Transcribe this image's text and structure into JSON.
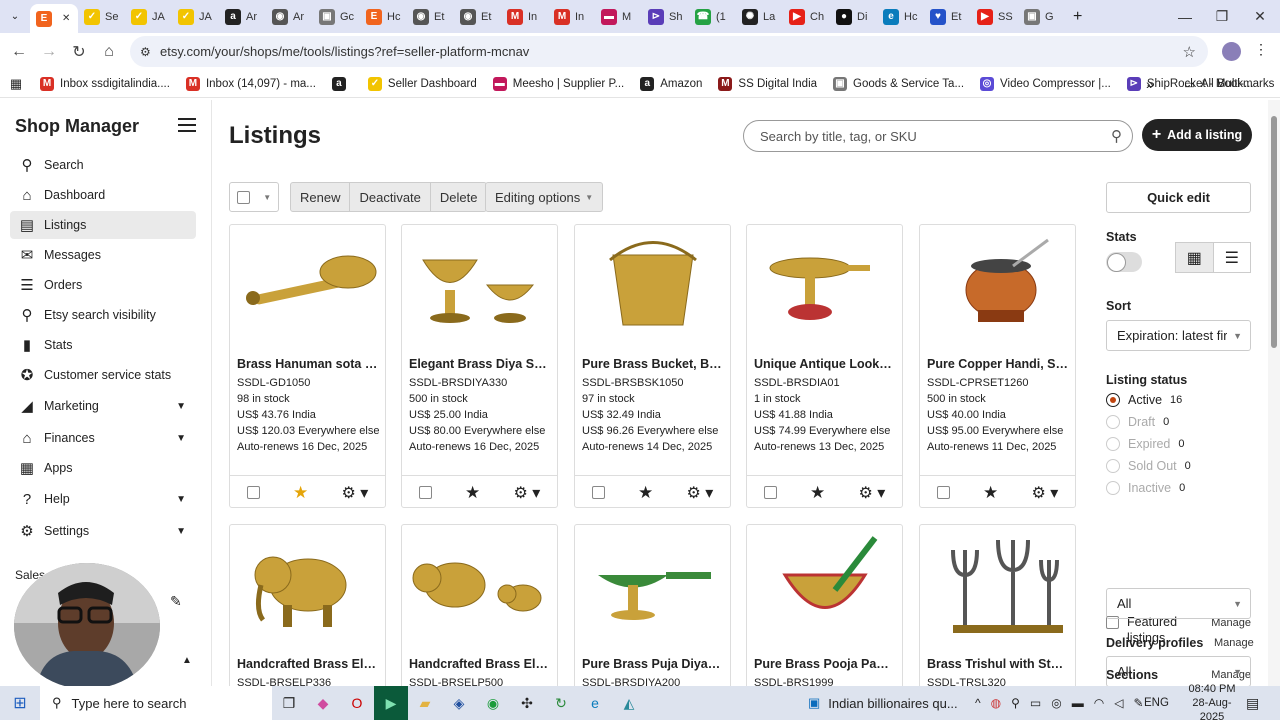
{
  "browser": {
    "tabs": [
      {
        "label": "",
        "icon": "etsy-icon",
        "color": "#f1641e",
        "glyph": "E",
        "active": true
      },
      {
        "label": "Se",
        "icon": "seller-icon",
        "color": "#f2c400",
        "glyph": "✓"
      },
      {
        "label": "JA",
        "icon": "seller-icon",
        "color": "#f2c400",
        "glyph": "✓"
      },
      {
        "label": "JA",
        "icon": "seller-icon",
        "color": "#f2c400",
        "glyph": "✓"
      },
      {
        "label": "Ar",
        "icon": "amazon-icon",
        "color": "#222",
        "glyph": "a"
      },
      {
        "label": "Ar",
        "icon": "globe-icon",
        "color": "#555",
        "glyph": "◉"
      },
      {
        "label": "Gc",
        "icon": "gst-icon",
        "color": "#777",
        "glyph": "▣"
      },
      {
        "label": "Hc",
        "icon": "etsy-icon",
        "color": "#f1641e",
        "glyph": "E"
      },
      {
        "label": "Et",
        "icon": "globe-icon",
        "color": "#555",
        "glyph": "◉"
      },
      {
        "label": "Et",
        "icon": "globe-icon",
        "color": "#555",
        "glyph": "◉"
      },
      {
        "label": "In",
        "icon": "gmail-icon",
        "color": "#d93025",
        "glyph": "M"
      },
      {
        "label": "In",
        "icon": "gmail-icon",
        "color": "#d93025",
        "glyph": "M"
      },
      {
        "label": "M",
        "icon": "meesho-icon",
        "color": "#c2185b",
        "glyph": "▬"
      },
      {
        "label": "Sh",
        "icon": "shiprocket-icon",
        "color": "#5a3db8",
        "glyph": "⊳"
      },
      {
        "label": "(1",
        "icon": "whatsapp-icon",
        "color": "#25a244",
        "glyph": "☎"
      },
      {
        "label": "La",
        "icon": "openai-icon",
        "color": "#222",
        "glyph": "✺"
      },
      {
        "label": "Ch",
        "icon": "youtube-icon",
        "color": "#e62117",
        "glyph": "▶"
      },
      {
        "label": "Di",
        "icon": "openai-icon",
        "color": "#111",
        "glyph": "●"
      },
      {
        "label": "Hc",
        "icon": "edge-icon",
        "color": "#0a7cbc",
        "glyph": "e"
      },
      {
        "label": "Et",
        "icon": "heart-icon",
        "color": "#2452c9",
        "glyph": "♥"
      },
      {
        "label": "SS",
        "icon": "youtube-icon",
        "color": "#e62117",
        "glyph": "▶"
      },
      {
        "label": "G",
        "icon": "gst-icon",
        "color": "#777",
        "glyph": "▣"
      }
    ],
    "new_tab": "+",
    "url": "etsy.com/your/shops/me/tools/listings?ref=seller-platform-mcnav",
    "bookmarks": [
      {
        "label": "Inbox ssdigitalindia....",
        "icon": "gmail-icon",
        "color": "#d93025",
        "glyph": "M"
      },
      {
        "label": "Inbox (14,097) - ma...",
        "icon": "gmail-icon",
        "color": "#d93025",
        "glyph": "M"
      },
      {
        "label": "",
        "icon": "amazon-icon",
        "color": "#222",
        "glyph": "a"
      },
      {
        "label": "Seller Dashboard",
        "icon": "seller-icon",
        "color": "#f2c400",
        "glyph": "✓"
      },
      {
        "label": "Meesho | Supplier P...",
        "icon": "meesho-icon",
        "color": "#c2185b",
        "glyph": "▬"
      },
      {
        "label": "Amazon",
        "icon": "amazon-icon",
        "color": "#222",
        "glyph": "a"
      },
      {
        "label": "SS Digital India",
        "icon": "ss-icon",
        "color": "#8b1a1a",
        "glyph": "M"
      },
      {
        "label": "Goods & Service Ta...",
        "icon": "gst-icon",
        "color": "#777",
        "glyph": "▣"
      },
      {
        "label": "Video Compressor |...",
        "icon": "video-icon",
        "color": "#5b4bd6",
        "glyph": "◎"
      },
      {
        "label": "ShipRocket - Multi-...",
        "icon": "shiprocket-icon",
        "color": "#5a3db8",
        "glyph": "⊳"
      }
    ],
    "more_bookmarks": "»",
    "all_bookmarks": "All Bookmarks"
  },
  "sidebar": {
    "title": "Shop Manager",
    "items": [
      {
        "label": "Search",
        "icon": "search-icon",
        "glyph": "⚲",
        "chevron": ""
      },
      {
        "label": "Dashboard",
        "icon": "home-icon",
        "glyph": "⌂",
        "chevron": ""
      },
      {
        "label": "Listings",
        "icon": "listings-icon",
        "glyph": "▤",
        "chevron": "",
        "active": true
      },
      {
        "label": "Messages",
        "icon": "messages-icon",
        "glyph": "✉",
        "chevron": ""
      },
      {
        "label": "Orders",
        "icon": "orders-icon",
        "glyph": "☰",
        "chevron": ""
      },
      {
        "label": "Etsy search visibility",
        "icon": "magnifier-icon",
        "glyph": "⚲",
        "chevron": ""
      },
      {
        "label": "Stats",
        "icon": "stats-icon",
        "glyph": "▮",
        "chevron": ""
      },
      {
        "label": "Customer service stats",
        "icon": "badge-icon",
        "glyph": "✪",
        "chevron": ""
      },
      {
        "label": "Marketing",
        "icon": "megaphone-icon",
        "glyph": "◢",
        "chevron": "▼"
      },
      {
        "label": "Finances",
        "icon": "bank-icon",
        "glyph": "⌂",
        "chevron": "▼"
      },
      {
        "label": "Apps",
        "icon": "apps-icon",
        "glyph": "▦",
        "chevron": ""
      },
      {
        "label": "Help",
        "icon": "help-icon",
        "glyph": "?",
        "chevron": "▼"
      },
      {
        "label": "Settings",
        "icon": "gear-icon",
        "glyph": "⚙",
        "chevron": "▼"
      }
    ],
    "sales_label": "Sales"
  },
  "main": {
    "title": "Listings",
    "search_placeholder": "Search by title, tag, or SKU",
    "add_listing": "Add a listing",
    "toolbar": {
      "renew": "Renew",
      "deactivate": "Deactivate",
      "delete": "Delete",
      "editing_options": "Editing options"
    },
    "listings": [
      {
        "name": "Brass Hanuman sota Ha...",
        "sku": "SSDL-GD1050",
        "stock": "98 in stock",
        "price_india": "US$ 43.76 India",
        "price_else": "US$ 120.03 Everywhere else",
        "renews": "Auto-renews 16 Dec, 2025",
        "featured": true,
        "img": "mace"
      },
      {
        "name": "Elegant Brass Diya Set - ...",
        "sku": "SSDL-BRSDIYA330",
        "stock": "500 in stock",
        "price_india": "US$ 25.00 India",
        "price_else": "US$ 80.00 Everywhere else",
        "renews": "Auto-renews 16 Dec, 2025",
        "featured": false,
        "img": "diya-set"
      },
      {
        "name": "Pure Brass Bucket, Bras...",
        "sku": "SSDL-BRSBSK1050",
        "stock": "97 in stock",
        "price_india": "US$ 32.49 India",
        "price_else": "US$ 96.26 Everywhere else",
        "renews": "Auto-renews 14 Dec, 2025",
        "featured": false,
        "img": "bucket"
      },
      {
        "name": "Unique Antique Look Po...",
        "sku": "SSDL-BRSDIA01",
        "stock": "1 in stock",
        "price_india": "US$ 41.88 India",
        "price_else": "US$ 74.99 Everywhere else",
        "renews": "Auto-renews 13 Dec, 2025",
        "featured": false,
        "img": "lamp"
      },
      {
        "name": "Pure Copper Handi, Sp...",
        "sku": "SSDL-CPRSET1260",
        "stock": "500 in stock",
        "price_india": "US$ 40.00 India",
        "price_else": "US$ 95.00 Everywhere else",
        "renews": "Auto-renews 11 Dec, 2025",
        "featured": false,
        "img": "handi"
      },
      {
        "name": "Handcrafted Brass Elep...",
        "sku": "SSDL-BRSELP336",
        "img": "elephant"
      },
      {
        "name": "Handcrafted Brass Elep...",
        "sku": "SSDL-BRSELP500",
        "img": "elephant-pair"
      },
      {
        "name": "Pure Brass Puja Diya wit...",
        "sku": "SSDL-BRSDIYA200",
        "img": "puja-diya"
      },
      {
        "name": "Pure Brass Pooja Panch ...",
        "sku": "SSDL-BRS1999",
        "img": "panch"
      },
      {
        "name": "Brass Trishul with Stand...",
        "sku": "SSDL-TRSL320",
        "img": "trishul"
      }
    ]
  },
  "right_panel": {
    "quick_edit": "Quick edit",
    "stats_label": "Stats",
    "sort_label": "Sort",
    "sort_value": "Expiration: latest first",
    "listing_status_label": "Listing status",
    "statuses": [
      {
        "label": "Active",
        "count": "16",
        "selected": true,
        "enabled": true
      },
      {
        "label": "Draft",
        "count": "0",
        "selected": false,
        "enabled": false
      },
      {
        "label": "Expired",
        "count": "0",
        "selected": false,
        "enabled": false
      },
      {
        "label": "Sold Out",
        "count": "0",
        "selected": false,
        "enabled": false
      },
      {
        "label": "Inactive",
        "count": "0",
        "selected": false,
        "enabled": false
      }
    ],
    "featured_label": "Featured listings",
    "manage": "Manage",
    "sections_label": "Sections",
    "sections_value": "All",
    "delivery_label": "Delivery profiles",
    "delivery_value": "All"
  },
  "taskbar": {
    "search_placeholder": "Type here to search",
    "news": "Indian billionaires qu...",
    "language": "ENG",
    "time": "08:40 PM",
    "date": "28-Aug-2025"
  },
  "colors": {
    "accent": "#f1641e",
    "dark_button": "#222222",
    "radio_selected": "#c0440f",
    "featured_star": "#e5a50a"
  }
}
